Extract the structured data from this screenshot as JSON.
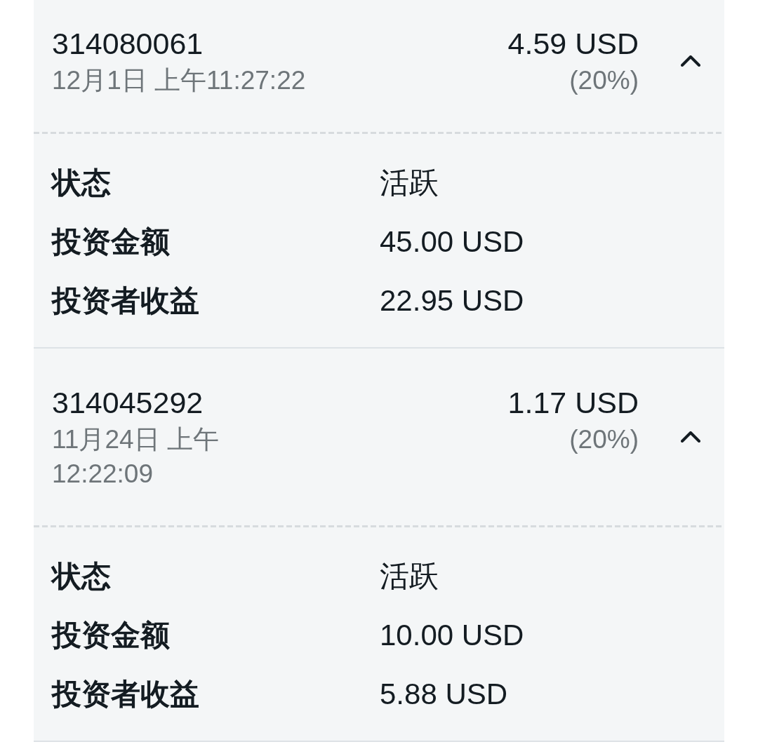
{
  "orders": [
    {
      "id": "314080061",
      "date": "12月1日 上午11:27:22",
      "amount": "4.59 USD",
      "percent": "(20%)",
      "expanded": true,
      "details": [
        {
          "label": "状态",
          "value": "活跃"
        },
        {
          "label": "投资金额",
          "value": "45.00 USD"
        },
        {
          "label": "投资者收益",
          "value": "22.95 USD"
        }
      ]
    },
    {
      "id": "314045292",
      "date": "11月24日 上午12:22:09",
      "amount": "1.17 USD",
      "percent": "(20%)",
      "expanded": true,
      "details": [
        {
          "label": "状态",
          "value": "活跃"
        },
        {
          "label": "投资金额",
          "value": "10.00 USD"
        },
        {
          "label": "投资者收益",
          "value": "5.88 USD"
        }
      ]
    }
  ]
}
